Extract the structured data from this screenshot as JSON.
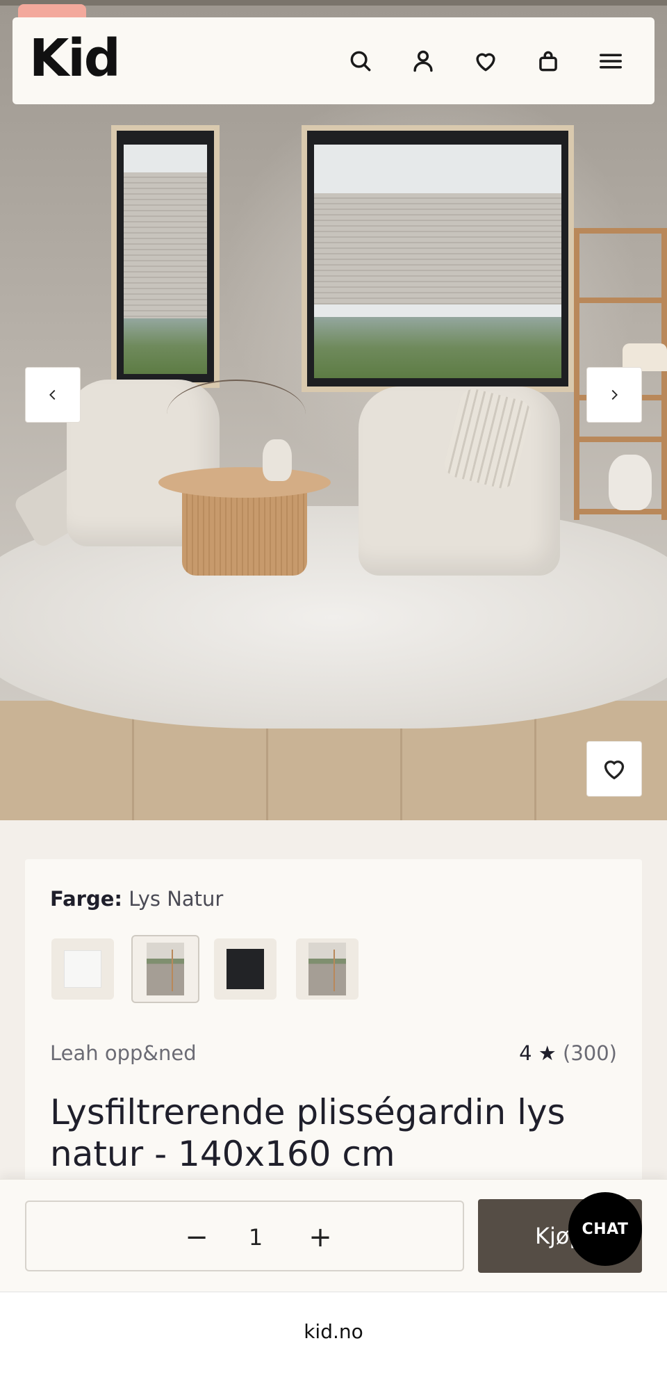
{
  "header": {
    "logo": "Kid",
    "icons": [
      "search-icon",
      "account-icon",
      "heart-icon",
      "bag-icon",
      "menu-icon"
    ]
  },
  "gallery": {
    "prev_icon": "chevron-left-icon",
    "next_icon": "chevron-right-icon",
    "favorite_icon": "heart-icon"
  },
  "product": {
    "color_label": "Farge:",
    "color_value": "Lys Natur",
    "swatches": [
      {
        "name": "white",
        "selected": false
      },
      {
        "name": "lys-natur",
        "selected": true
      },
      {
        "name": "black",
        "selected": false
      },
      {
        "name": "room",
        "selected": false
      }
    ],
    "brand": "Leah opp&ned",
    "rating": "4",
    "rating_star": "★",
    "review_count": "(300)",
    "title": "Lysfiltrerende plisségardin lys natur - 140x160 cm"
  },
  "purchase": {
    "minus": "−",
    "quantity": "1",
    "plus": "+",
    "buy_label": "Kjøp",
    "chat_label": "CHAT"
  },
  "browser": {
    "url": "kid.no"
  },
  "colors": {
    "header_bg": "#fbf9f4",
    "page_bg": "#f3efea",
    "buy_button": "#554d45",
    "chat_button": "#000000",
    "promo_tab": "#f3a99c"
  }
}
